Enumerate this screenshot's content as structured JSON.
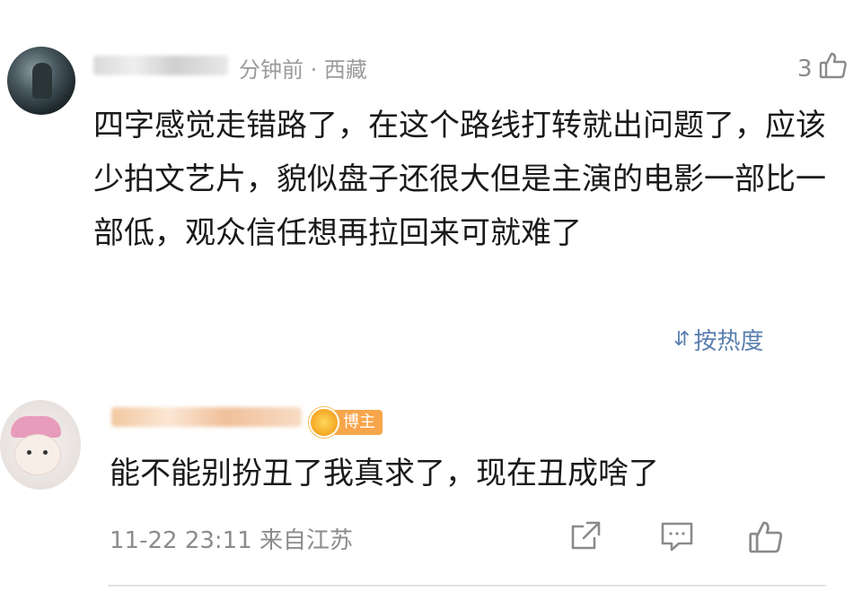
{
  "comment": {
    "time_location": "分钟前 · 西藏",
    "like_count": "3",
    "text": "四字感觉走错路了，在这个路线打转就出问题了，应该少拍文艺片，貌似盘子还很大但是主演的电影一部比一部低，观众信任想再拉回来可就难了"
  },
  "sort": {
    "label": "按热度"
  },
  "reply": {
    "author_badge": "博主",
    "text": "能不能别扮丑了我真求了，现在丑成啥了",
    "meta": "11-22 23:11 来自江苏"
  },
  "icons": {
    "like": "thumbs-up-icon",
    "share": "share-icon",
    "comment": "comment-icon",
    "sort": "sort-arrows-icon"
  },
  "colors": {
    "link_blue": "#5a7fb0",
    "badge_orange": "#f7a54a",
    "meta_gray": "#8c8c8c"
  }
}
